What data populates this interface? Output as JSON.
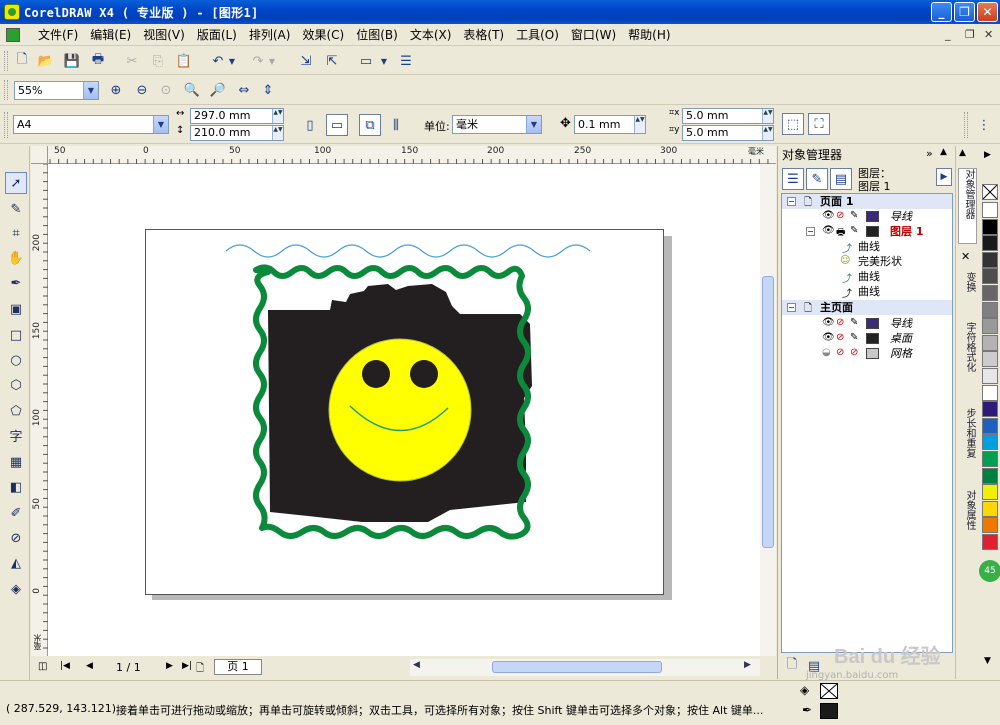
{
  "window": {
    "title": "CorelDRAW X4 ( 专业版 ) - [图形1]",
    "controls": [
      "_",
      "❐",
      "✕"
    ]
  },
  "menu": [
    "文件(F)",
    "编辑(E)",
    "视图(V)",
    "版面(L)",
    "排列(A)",
    "效果(C)",
    "位图(B)",
    "文本(X)",
    "表格(T)",
    "工具(O)",
    "窗口(W)",
    "帮助(H)"
  ],
  "zoom": {
    "value": "55%"
  },
  "property_bar": {
    "paper": "A4",
    "width": "297.0 mm",
    "height": "210.0 mm",
    "unit_label": "单位:",
    "unit": "毫米",
    "nudge": "0.1 mm",
    "dup_x": "5.0 mm",
    "dup_y": "5.0 mm"
  },
  "rulers": {
    "h_ticks": [
      "50",
      "0",
      "50",
      "100",
      "150",
      "200",
      "250",
      "300",
      "毫米"
    ],
    "v_ticks": [
      "200",
      "150",
      "100",
      "50",
      "0",
      "毫米"
    ]
  },
  "page_nav": {
    "counter": "1 / 1",
    "tab": "页 1"
  },
  "docker": {
    "title": "对象管理器",
    "layer_label": "图层：",
    "layer_name": "图层 1",
    "rows": [
      {
        "kind": "page",
        "label": "页面 1"
      },
      {
        "kind": "layer",
        "label": "导线",
        "color": "#3a2a7a"
      },
      {
        "kind": "layer-active",
        "label": "图层 1",
        "color": "#222222"
      },
      {
        "kind": "object",
        "label": "曲线",
        "icon": "curve"
      },
      {
        "kind": "object",
        "label": "完美形状",
        "icon": "shape"
      },
      {
        "kind": "object",
        "label": "曲线",
        "icon": "curve"
      },
      {
        "kind": "object",
        "label": "曲线",
        "icon": "curve-black"
      },
      {
        "kind": "page",
        "label": "主页面"
      },
      {
        "kind": "layer",
        "label": "导线",
        "color": "#3a2a7a"
      },
      {
        "kind": "layer",
        "label": "桌面",
        "color": "#222222"
      },
      {
        "kind": "layer",
        "label": "网格",
        "color": "#c8c8c8"
      }
    ]
  },
  "side_tabs": [
    "对象管理器",
    "变换",
    "字符格式化",
    "步长和重复",
    "对象属性"
  ],
  "palette": [
    "#ffffff",
    "#000000",
    "#1a1a1a",
    "#333333",
    "#4d4d4d",
    "#666666",
    "#808080",
    "#999999",
    "#b3b3b3",
    "#cccccc",
    "#e6e6e6",
    "#ffffff",
    "#2e1a7a",
    "#1f5fbf",
    "#00a0e0",
    "#00a050",
    "#008040",
    "#f0f000",
    "#ffd700",
    "#f07800",
    "#e02030",
    "#c01050",
    "#a0208a",
    "#d060b0",
    "#e0a0a0",
    "#f0c080"
  ],
  "status": {
    "coords": "( 287.529, 143.121)",
    "hint": "接着单击可进行拖动或缩放；再单击可旋转或倾斜；双击工具，可选择所有对象；按住 Shift 键单击可选择多个对象；按住 Alt 键单..."
  },
  "watermark": {
    "text": "Bai du 经验",
    "url": "jingyan.baidu.com"
  },
  "colors": {
    "title_bar": "#0a5fd8",
    "camera": "#231f20",
    "smiley": "#ffff00",
    "frame": "#0a8a3a",
    "wave": "#4aa0d8"
  }
}
